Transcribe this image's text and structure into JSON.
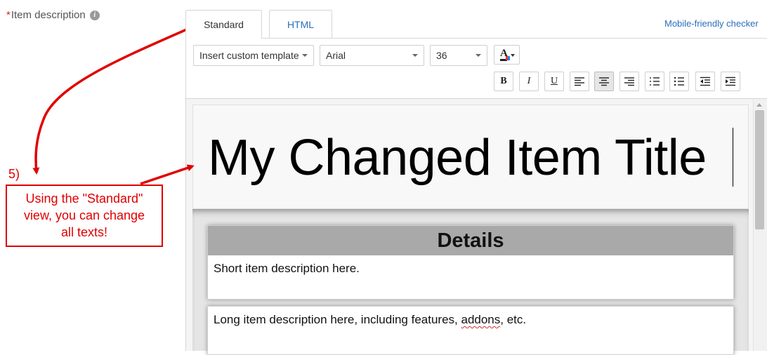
{
  "field": {
    "required_marker": "*",
    "label": "Item description",
    "info_icon": "info-icon"
  },
  "tabs": [
    {
      "label": "Standard",
      "active": true
    },
    {
      "label": "HTML",
      "active": false
    }
  ],
  "mobile_checker_link": "Mobile-friendly checker",
  "toolbar": {
    "template_dropdown": "Insert custom template",
    "font_dropdown": "Arial",
    "size_dropdown": "36",
    "font_color_letter": "A",
    "format_buttons": [
      {
        "icon": "bold-icon",
        "label": "B",
        "active": false
      },
      {
        "icon": "italic-icon",
        "label": "I",
        "active": false
      },
      {
        "icon": "underline-icon",
        "label": "U",
        "active": false
      },
      {
        "icon": "align-left-icon",
        "active": false
      },
      {
        "icon": "align-center-icon",
        "active": true
      },
      {
        "icon": "align-right-icon",
        "active": false
      },
      {
        "icon": "numbered-list-icon",
        "active": false
      },
      {
        "icon": "bullet-list-icon",
        "active": false
      },
      {
        "icon": "outdent-icon",
        "active": false
      },
      {
        "icon": "indent-icon",
        "active": false
      }
    ]
  },
  "content": {
    "title": "My Changed Item Title",
    "details_header": "Details",
    "short_description": "Short item description here.",
    "long_description_before": "Long item description here, including features, ",
    "long_description_flagged": "addons",
    "long_description_after": ", etc."
  },
  "annotation": {
    "step": "5)",
    "callout_lines": [
      "Using the \"Standard\"",
      "view, you can change",
      "all texts!"
    ],
    "color": "#e00000"
  },
  "colors": {
    "link": "#2a6ebb",
    "required": "#d9261c",
    "details_header_bg": "#a9a9a9"
  }
}
